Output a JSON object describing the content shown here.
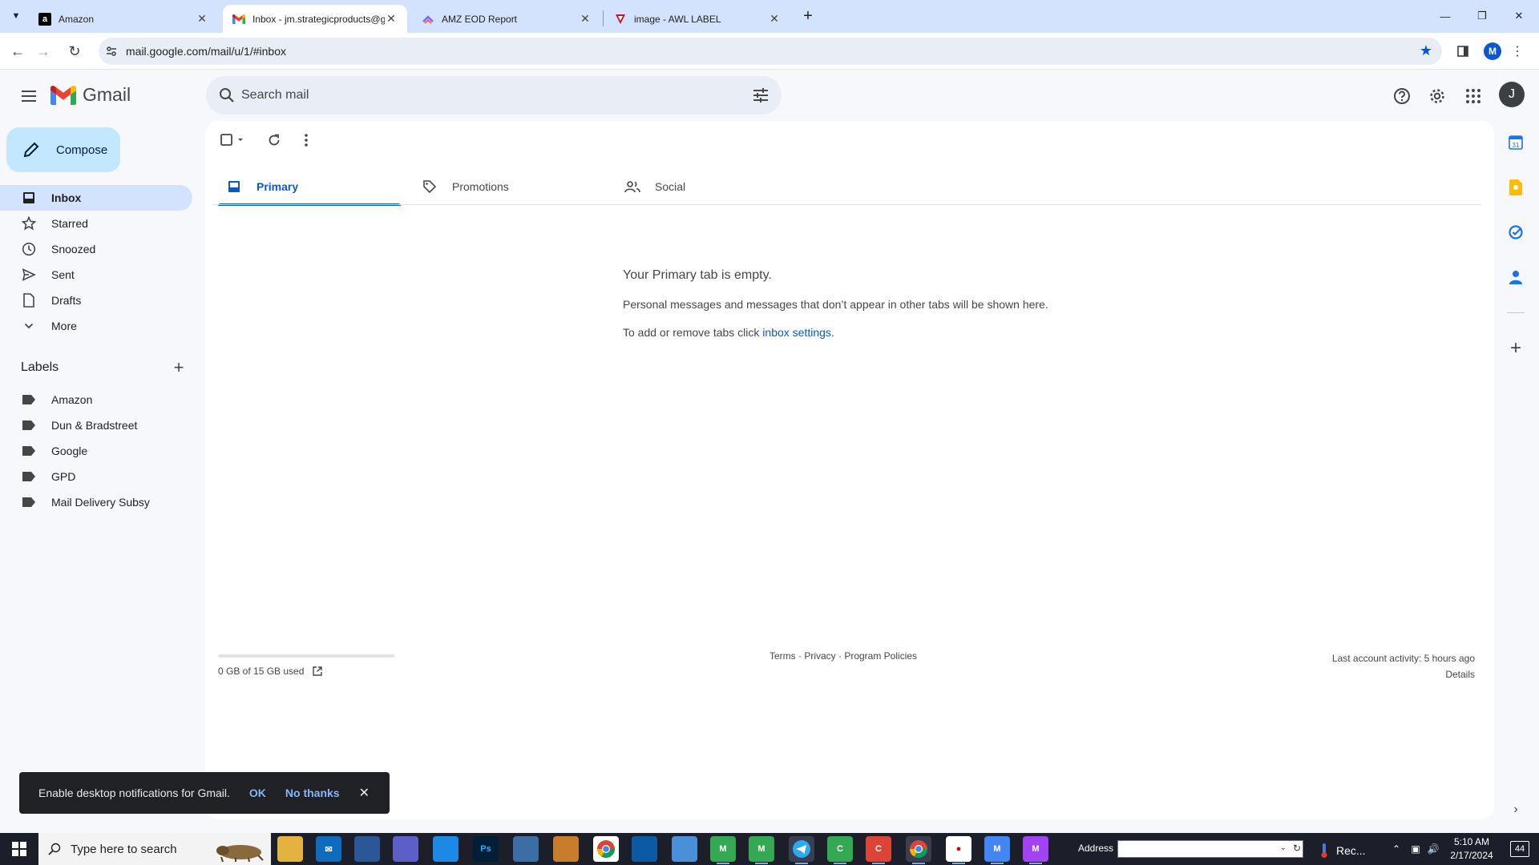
{
  "browser": {
    "tabs": [
      {
        "title": "Amazon",
        "favicon": "amazon-logo",
        "active": false
      },
      {
        "title": "Inbox - jm.strategicproducts@g",
        "favicon": "gmail-logo",
        "active": true
      },
      {
        "title": "AMZ EOD Report",
        "favicon": "clickup-logo",
        "active": false
      },
      {
        "title": "image - AWL LABEL",
        "favicon": "monday-logo",
        "active": false
      }
    ],
    "url": "mail.google.com/mail/u/1/#inbox",
    "profile_initial": "M"
  },
  "gmail": {
    "app_name": "Gmail",
    "search_placeholder": "Search mail",
    "account_initial": "J",
    "compose_label": "Compose",
    "nav": [
      {
        "label": "Inbox",
        "icon": "inbox-icon",
        "active": true
      },
      {
        "label": "Starred",
        "icon": "star-icon",
        "active": false
      },
      {
        "label": "Snoozed",
        "icon": "clock-icon",
        "active": false
      },
      {
        "label": "Sent",
        "icon": "send-icon",
        "active": false
      },
      {
        "label": "Drafts",
        "icon": "draft-icon",
        "active": false
      },
      {
        "label": "More",
        "icon": "chevron-down-icon",
        "active": false
      }
    ],
    "labels_heading": "Labels",
    "labels": [
      "Amazon",
      "Dun & Bradstreet",
      "Google",
      "GPD",
      "Mail Delivery Subsy"
    ],
    "category_tabs": [
      {
        "label": "Primary",
        "icon": "inbox-tray-icon",
        "active": true
      },
      {
        "label": "Promotions",
        "icon": "tag-icon",
        "active": false
      },
      {
        "label": "Social",
        "icon": "people-icon",
        "active": false
      }
    ],
    "empty_state": {
      "title": "Your Primary tab is empty.",
      "line1": "Personal messages and messages that don’t appear in other tabs will be shown here.",
      "line2_prefix": "To add or remove tabs click ",
      "line2_link": "inbox settings",
      "line2_suffix": "."
    },
    "footer": {
      "storage": "0 GB of 15 GB used",
      "storage_fraction": 0.0,
      "links": "Terms · Privacy · Program Policies",
      "last_activity": "Last account activity: 5 hours ago",
      "details": "Details"
    },
    "snackbar": {
      "text": "Enable desktop notifications for Gmail.",
      "ok": "OK",
      "no_thanks": "No thanks"
    },
    "colors": {
      "accent": "#0b57d0",
      "compose_bg": "#c2e7ff",
      "active_nav_bg": "#d3e3fd"
    }
  },
  "taskbar": {
    "search_placeholder": "Type here to search",
    "address_label": "Address",
    "tray_app": "Rec...",
    "time": "5:10 AM",
    "date": "2/17/2024",
    "notification_count": "44"
  }
}
